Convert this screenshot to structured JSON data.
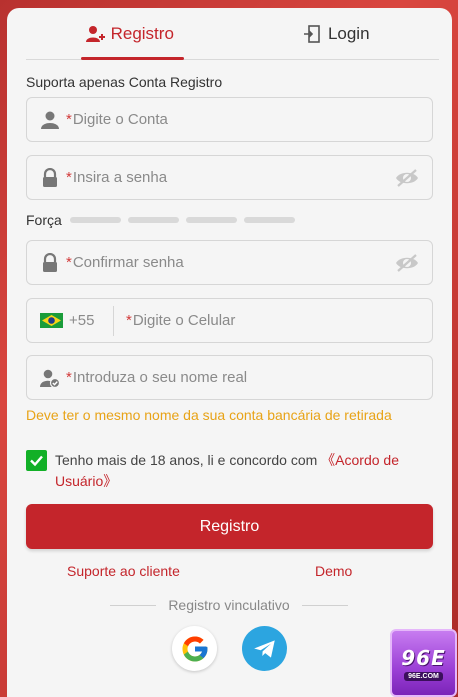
{
  "tabs": [
    {
      "label": "Registro",
      "icon": "user-add-icon",
      "active": true
    },
    {
      "label": "Login",
      "icon": "door-login-icon",
      "active": false
    }
  ],
  "subtitle": "Suporta apenas Conta Registro",
  "fields": {
    "account": {
      "required_mark": "*",
      "placeholder": "Digite o Conta",
      "icon": "user-icon"
    },
    "password": {
      "required_mark": "*",
      "placeholder": "Insira a senha",
      "icon": "lock-icon"
    },
    "confirm": {
      "required_mark": "*",
      "placeholder": "Confirmar senha",
      "icon": "lock-icon"
    },
    "phone": {
      "country_code": "+55",
      "flag": "brazil-flag-icon",
      "required_mark": "*",
      "placeholder": "Digite o Celular"
    },
    "real_name": {
      "required_mark": "*",
      "placeholder": "Introduza o seu nome real",
      "icon": "user-verified-icon"
    }
  },
  "strength": {
    "label": "Força",
    "segments": 4,
    "filled": 0
  },
  "name_warning": "Deve ter o mesmo nome da sua conta bancária de retirada",
  "agreement": {
    "checked": true,
    "text": "Tenho mais de 18 anos, li e concordo com ",
    "link": "《Acordo de Usuário》"
  },
  "submit_label": "Registro",
  "links": {
    "support": "Suporte ao cliente",
    "demo": "Demo"
  },
  "separator_text": "Registro vinculativo",
  "social": [
    "google-icon",
    "telegram-icon"
  ],
  "brand": {
    "name": "96E",
    "domain": "96E.COM"
  },
  "colors": {
    "accent": "#c4252b",
    "warning": "#e8a317",
    "checkbox": "#12b027"
  }
}
